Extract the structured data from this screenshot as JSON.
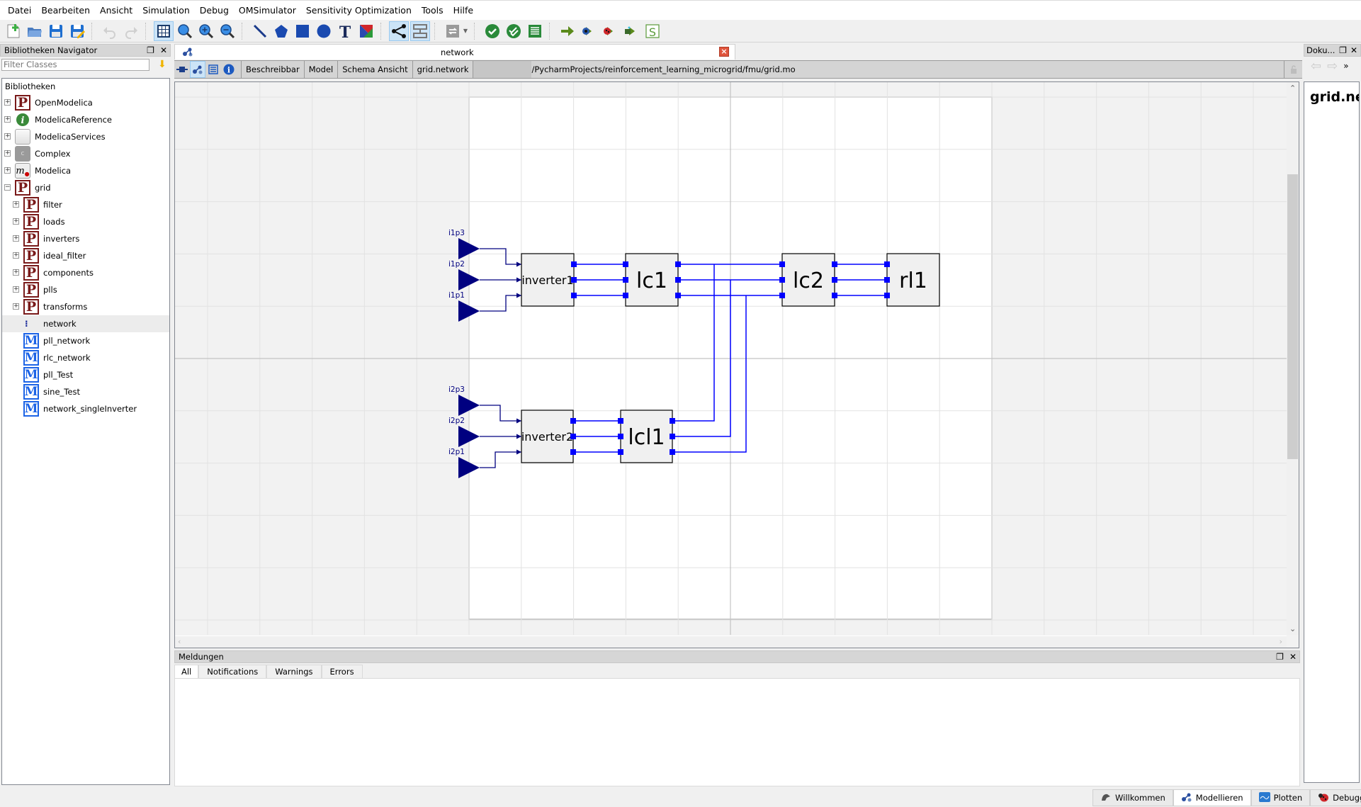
{
  "menubar": {
    "items": [
      "Datei",
      "Bearbeiten",
      "Ansicht",
      "Simulation",
      "Debug",
      "OMSimulator",
      "Sensitivity Optimization",
      "Tools",
      "Hilfe"
    ]
  },
  "toolbar": {
    "groups": [
      [
        "new-file-icon",
        "open-folder-icon",
        "save-icon",
        "save-as-icon"
      ],
      [
        "undo-icon",
        "redo-icon"
      ],
      [
        "grid-icon",
        "zoom-icon",
        "zoom-in-icon",
        "zoom-out-icon"
      ],
      [
        "line-icon",
        "polygon-icon",
        "rectangle-icon",
        "ellipse-icon",
        "text-icon",
        "bitmap-icon"
      ],
      [
        "connect-mode-icon",
        "transition-mode-icon"
      ],
      [
        "swap-icon"
      ],
      [
        "check-model-icon",
        "check-all-icon",
        "instantiate-icon"
      ],
      [
        "simulate-icon",
        "simulate-debug-icon",
        "simulate-algorithmic-debug-icon",
        "simulate-animation-icon",
        "simulation-setup-icon"
      ]
    ]
  },
  "library_navigator": {
    "title": "Bibliotheken Navigator",
    "filter_placeholder": "Filter Classes",
    "tree_header": "Bibliotheken",
    "items": [
      {
        "label": "OpenModelica",
        "icon": "package-icon",
        "level": 0,
        "expander": "+"
      },
      {
        "label": "ModelicaReference",
        "icon": "info-icon",
        "level": 0,
        "expander": "+"
      },
      {
        "label": "ModelicaServices",
        "icon": "blank-package-icon",
        "level": 0,
        "expander": "+"
      },
      {
        "label": "Complex",
        "icon": "complex-icon",
        "level": 0,
        "expander": "+"
      },
      {
        "label": "Modelica",
        "icon": "modelica-icon",
        "level": 0,
        "expander": "+"
      },
      {
        "label": "grid",
        "icon": "package-icon",
        "level": 0,
        "expander": "-"
      },
      {
        "label": "filter",
        "icon": "package-icon",
        "level": 1,
        "expander": "+"
      },
      {
        "label": "loads",
        "icon": "package-icon",
        "level": 1,
        "expander": "+"
      },
      {
        "label": "inverters",
        "icon": "package-icon",
        "level": 1,
        "expander": "+"
      },
      {
        "label": "ideal_filter",
        "icon": "package-icon",
        "level": 1,
        "expander": "+"
      },
      {
        "label": "components",
        "icon": "package-icon",
        "level": 1,
        "expander": "+"
      },
      {
        "label": "plls",
        "icon": "package-icon",
        "level": 1,
        "expander": "+"
      },
      {
        "label": "transforms",
        "icon": "package-icon",
        "level": 1,
        "expander": "+"
      },
      {
        "label": "network",
        "icon": "network-model-icon",
        "level": 1,
        "expander": "",
        "selected": true
      },
      {
        "label": "pll_network",
        "icon": "model-icon",
        "level": 1,
        "expander": ""
      },
      {
        "label": "rlc_network",
        "icon": "model-icon",
        "level": 1,
        "expander": ""
      },
      {
        "label": "pll_Test",
        "icon": "model-icon",
        "level": 1,
        "expander": ""
      },
      {
        "label": "sine_Test",
        "icon": "model-icon",
        "level": 1,
        "expander": ""
      },
      {
        "label": "network_singleInverter",
        "icon": "model-icon",
        "level": 1,
        "expander": ""
      }
    ]
  },
  "document": {
    "tab_title": "network",
    "model_toolbar": {
      "restriction": "Beschreibbar",
      "class_type": "Model",
      "view": "Schema Ansicht",
      "class_name": "grid.network",
      "file_path": "/PycharmProjects/reinforcement_learning_microgrid/fmu/grid.mo"
    }
  },
  "diagram": {
    "inputs": [
      {
        "label": "i1p3"
      },
      {
        "label": "i1p2"
      },
      {
        "label": "i1p1"
      },
      {
        "label": "i2p3"
      },
      {
        "label": "i2p2"
      },
      {
        "label": "i2p1"
      }
    ],
    "components": [
      {
        "name": "inverter1"
      },
      {
        "name": "lc1"
      },
      {
        "name": "lc2"
      },
      {
        "name": "rl1"
      },
      {
        "name": "inverter2"
      },
      {
        "name": "lcl1"
      }
    ],
    "connections": [
      "i1p3 -> inverter1",
      "i1p2 -> inverter1",
      "i1p1 -> inverter1",
      "inverter1 -> lc1",
      "lc1 -> lc2",
      "lc2 -> rl1",
      "i2p3 -> inverter2",
      "i2p2 -> inverter2",
      "i2p1 -> inverter2",
      "inverter2 -> lcl1",
      "lcl1 -> lc2"
    ],
    "colors": {
      "input_fill": "#000080",
      "connection_line": "#0000ff",
      "port_fill": "#0000ff",
      "block_fill": "#f0f0f0"
    }
  },
  "messages": {
    "title": "Meldungen",
    "tabs": [
      "All",
      "Notifications",
      "Warnings",
      "Errors"
    ],
    "active_tab": "All"
  },
  "documentation": {
    "title": "Doku...",
    "heading": "grid.net"
  },
  "perspectives": [
    {
      "label": "Willkommen",
      "icon": "welcome-icon"
    },
    {
      "label": "Modellieren",
      "icon": "modeling-icon",
      "active": true
    },
    {
      "label": "Plotten",
      "icon": "plotting-icon"
    },
    {
      "label": "Debugging",
      "icon": "debugging-icon"
    }
  ]
}
